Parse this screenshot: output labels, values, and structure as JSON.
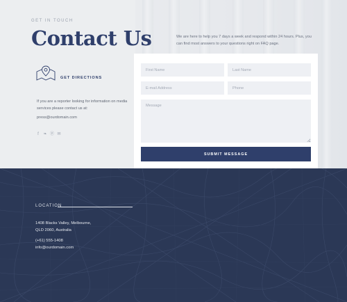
{
  "header": {
    "eyebrow": "GET IN TOUCH",
    "title": "Contact Us",
    "intro": "We are here to help you 7 days a week and respond within 24 hours. Plus, you can find most answers to your questions right on FAQ page."
  },
  "sidebar": {
    "directions_label": "GET DIRECTIONS",
    "reporter_text": "If you are a reporter looking for information on media services please contact us at:",
    "press_email": "press@ourdomain.com",
    "social": [
      {
        "name": "facebook-icon",
        "glyph": "f"
      },
      {
        "name": "twitter-icon",
        "glyph": "❧"
      },
      {
        "name": "pinterest-icon",
        "glyph": "ⓟ"
      },
      {
        "name": "mail-icon",
        "glyph": "✉"
      }
    ]
  },
  "form": {
    "first_name_placeholder": "First Name",
    "last_name_placeholder": "Last Name",
    "email_placeholder": "E-mail Address",
    "phone_placeholder": "Phone",
    "message_placeholder": "Message",
    "submit_label": "SUBMIT MESSAGE"
  },
  "location": {
    "title": "LOCATION",
    "address_line1": "1408 Blacks Valley, Melbourne,",
    "address_line2": "QLD 2060, Australia",
    "phone": "(+61) 555-1408",
    "email": "info@ourdomain.com"
  },
  "colors": {
    "accent": "#2f3f6b",
    "map_background": "#2b3856",
    "top_background": "#eceef0"
  }
}
